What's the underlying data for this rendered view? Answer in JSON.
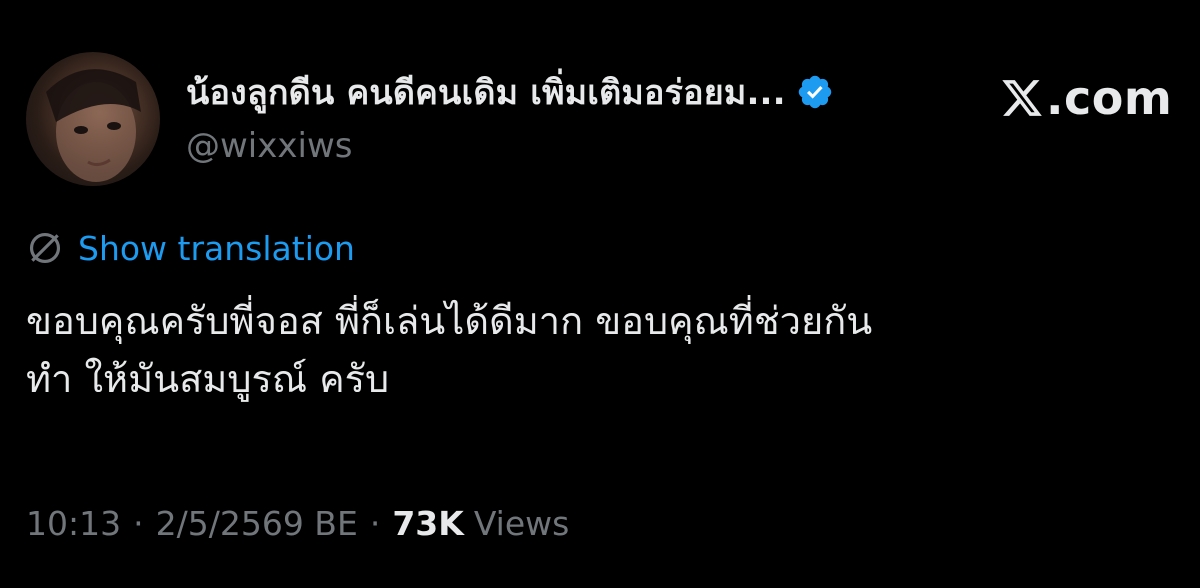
{
  "author": {
    "display_name": "น้องลูกดีน คนดีคนเดิม เพิ่มเติมอร่อยม...",
    "handle": "@wixxiws",
    "verified": true,
    "avatar_icon": "profile-photo"
  },
  "brand": {
    "text": ".com",
    "logo_icon": "x-logo-icon"
  },
  "translation": {
    "link_label": "Show translation",
    "icon": "globe-icon"
  },
  "tweet": {
    "lines": [
      "ขอบคุณครับพี่จอส พี่ก็เล่นได้ดีมาก ขอบคุณที่ช่วยกัน",
      "ทำ ให้มันสมบูรณ์ ครับ"
    ]
  },
  "meta": {
    "time": "10:13",
    "separator": "·",
    "date": "2/5/2569 BE",
    "views_count": "73K",
    "views_label": "Views"
  },
  "colors": {
    "background": "#000000",
    "primary_text": "#e7e9ea",
    "secondary_text": "#71767b",
    "link": "#1d9bf0",
    "verified": "#1d9bf0"
  }
}
